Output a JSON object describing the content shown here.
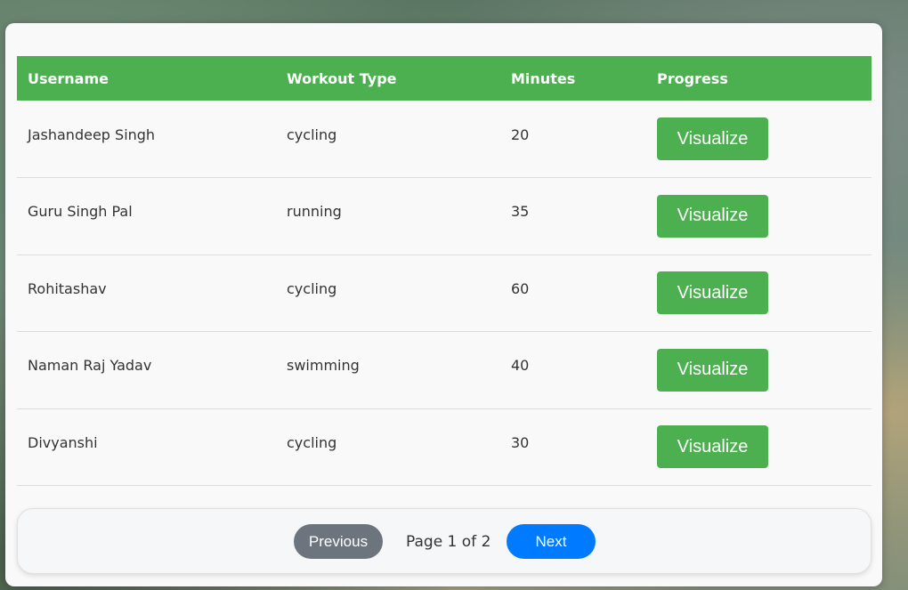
{
  "table": {
    "headers": [
      "Username",
      "Workout Type",
      "Minutes",
      "Progress"
    ],
    "rows": [
      {
        "username": "Jashandeep Singh",
        "workout_type": "cycling",
        "minutes": "20",
        "action": "Visualize"
      },
      {
        "username": "Guru Singh Pal",
        "workout_type": "running",
        "minutes": "35",
        "action": "Visualize"
      },
      {
        "username": "Rohitashav",
        "workout_type": "cycling",
        "minutes": "60",
        "action": "Visualize"
      },
      {
        "username": "Naman Raj Yadav",
        "workout_type": "swimming",
        "minutes": "40",
        "action": "Visualize"
      },
      {
        "username": "Divyanshi",
        "workout_type": "cycling",
        "minutes": "30",
        "action": "Visualize"
      }
    ]
  },
  "pagination": {
    "previous_label": "Previous",
    "page_info": "Page 1 of 2",
    "next_label": "Next"
  },
  "colors": {
    "header_bg": "#4caf50",
    "action_button": "#4caf50",
    "previous_button": "#6c757d",
    "next_button": "#007bff"
  }
}
